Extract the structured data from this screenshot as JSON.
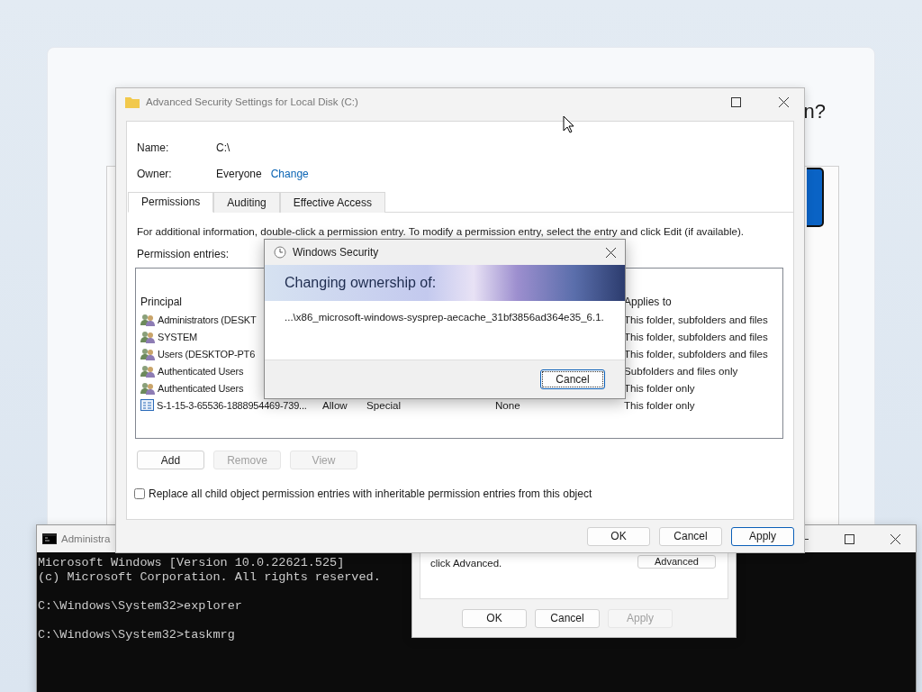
{
  "background_window": {
    "heading": "n?"
  },
  "console": {
    "title": "Administra",
    "blocks": [
      [
        "Microsoft Windows [Version 10.0.22621.525]",
        "(c) Microsoft Corporation. All rights reserved."
      ],
      [
        "C:\\Windows\\System32>explorer"
      ],
      [
        "C:\\Windows\\System32>taskmrg"
      ]
    ]
  },
  "properties_dialog": {
    "note": "click Advanced.",
    "advanced_button": "Advanced",
    "buttons": [
      {
        "label": "OK",
        "disabled": false
      },
      {
        "label": "Cancel",
        "disabled": false
      },
      {
        "label": "Apply",
        "disabled": true
      }
    ]
  },
  "security_window": {
    "title": "Advanced Security Settings for Local Disk (C:)",
    "name_label": "Name:",
    "name": "C:\\",
    "owner_label": "Owner:",
    "owner": "Everyone",
    "change_link": "Change",
    "tabs": [
      {
        "label": "Permissions",
        "selected": true
      },
      {
        "label": "Auditing",
        "selected": false
      },
      {
        "label": "Effective Access",
        "selected": false
      }
    ],
    "instructions": "For additional information, double-click a permission entry. To modify a permission entry, select the entry and click Edit (if available).",
    "entries_label": "Permission entries:",
    "columns": {
      "principal": "Principal",
      "applies_to": "Applies to"
    },
    "rows": [
      {
        "kind": "group",
        "principal": "Administrators (DESKT",
        "applies_to": "This folder, subfolders and files"
      },
      {
        "kind": "group",
        "principal": "SYSTEM",
        "applies_to": "This folder, subfolders and files"
      },
      {
        "kind": "group",
        "principal": "Users (DESKTOP-PT6",
        "applies_to": "This folder, subfolders and files"
      },
      {
        "kind": "group",
        "principal": "Authenticated Users",
        "applies_to": "Subfolders and files only"
      },
      {
        "kind": "group",
        "principal": "Authenticated Users",
        "applies_to": "This folder only"
      },
      {
        "kind": "sid",
        "principal": "S-1-15-3-65536-1888954469-739...",
        "type": "Allow",
        "access": "Special",
        "inherited": "None",
        "applies_to": "This folder only"
      }
    ],
    "entry_buttons": [
      {
        "label": "Add",
        "disabled": false
      },
      {
        "label": "Remove",
        "disabled": true
      },
      {
        "label": "View",
        "disabled": true
      }
    ],
    "replace_checkbox": {
      "label": "Replace all child object permission entries with inheritable permission entries from this object",
      "checked": false
    },
    "buttons": [
      {
        "label": "OK",
        "default": false
      },
      {
        "label": "Cancel",
        "default": false
      },
      {
        "label": "Apply",
        "default": true
      }
    ]
  },
  "windows_security": {
    "title": "Windows Security",
    "banner": "Changing ownership of:",
    "path": "...\\x86_microsoft-windows-sysprep-aecache_31bf3856ad364e35_6.1.",
    "button": "Cancel"
  }
}
